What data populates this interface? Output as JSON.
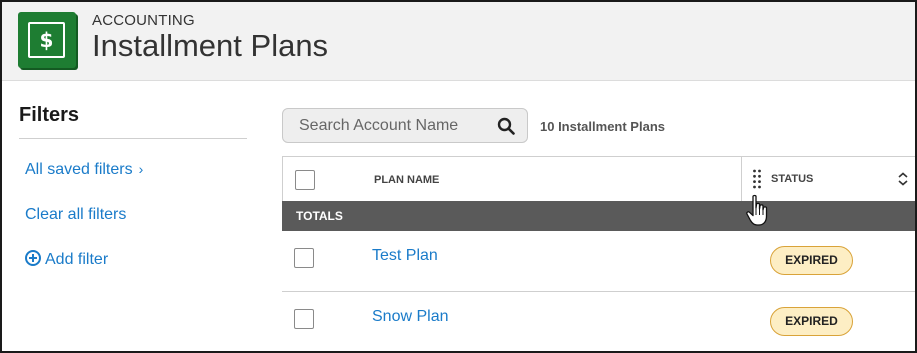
{
  "header": {
    "eyebrow": "ACCOUNTING",
    "title": "Installment Plans",
    "icon_symbol": "$",
    "icon_color": "#1e7d32"
  },
  "sidebar": {
    "title": "Filters",
    "links": {
      "all_saved": "All saved filters",
      "clear_all": "Clear all filters",
      "add_filter": "Add filter"
    }
  },
  "search": {
    "placeholder": "Search Account Name",
    "value": ""
  },
  "count_label": "10 Installment Plans",
  "table": {
    "columns": {
      "plan_name": "PLAN NAME",
      "status": "STATUS"
    },
    "totals_label": "TOTALS",
    "rows": [
      {
        "name": "Test Plan",
        "status": "EXPIRED"
      },
      {
        "name": "Snow Plan",
        "status": "EXPIRED"
      }
    ]
  },
  "colors": {
    "link": "#1a7bc9",
    "badge_bg": "#fdeec4",
    "badge_border": "#d9a339",
    "totals_bg": "#5a5a5a"
  }
}
